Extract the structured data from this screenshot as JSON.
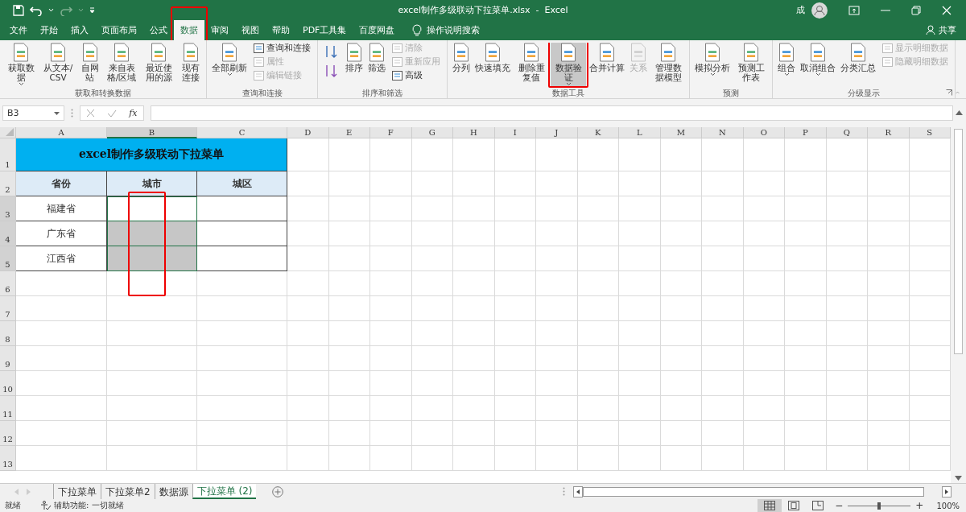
{
  "window": {
    "title": "excel制作多级联动下拉菜单.xlsx  -  Excel",
    "user": "成",
    "share": "共享"
  },
  "tabs": [
    {
      "label": "文件",
      "selected": false
    },
    {
      "label": "开始",
      "selected": false
    },
    {
      "label": "插入",
      "selected": false
    },
    {
      "label": "页面布局",
      "selected": false
    },
    {
      "label": "公式",
      "selected": false
    },
    {
      "label": "数据",
      "selected": true
    },
    {
      "label": "审阅",
      "selected": false
    },
    {
      "label": "视图",
      "selected": false
    },
    {
      "label": "帮助",
      "selected": false
    },
    {
      "label": "PDF工具集",
      "selected": false
    },
    {
      "label": "百度网盘",
      "selected": false
    }
  ],
  "tell_me": "操作说明搜索",
  "ribbon_groups": [
    {
      "label": "获取和转换数据",
      "items": [
        {
          "kind": "large",
          "label": "获取数据",
          "dropdown": true,
          "disabled": false,
          "selected": false
        },
        {
          "kind": "large",
          "label": "从文本/CSV",
          "dropdown": false,
          "disabled": false,
          "selected": false
        },
        {
          "kind": "large",
          "label": "自网站",
          "dropdown": false,
          "disabled": false,
          "selected": false
        },
        {
          "kind": "large",
          "label": "来自表格/区域",
          "dropdown": false,
          "disabled": false,
          "selected": false
        },
        {
          "kind": "large",
          "label": "最近使用的源",
          "dropdown": false,
          "disabled": false,
          "selected": false
        },
        {
          "kind": "large",
          "label": "现有连接",
          "dropdown": false,
          "disabled": false,
          "selected": false
        }
      ]
    },
    {
      "label": "查询和连接",
      "items": [
        {
          "kind": "large",
          "label": "全部刷新",
          "dropdown": true,
          "disabled": false,
          "selected": false
        },
        {
          "kind": "stack",
          "items": [
            {
              "label": "查询和连接",
              "disabled": false
            },
            {
              "label": "属性",
              "disabled": true
            },
            {
              "label": "编辑链接",
              "disabled": true
            }
          ]
        }
      ]
    },
    {
      "label": "排序和筛选",
      "items": [
        {
          "kind": "sort"
        },
        {
          "kind": "large",
          "label": "排序",
          "dropdown": false,
          "disabled": false,
          "selected": false
        },
        {
          "kind": "large",
          "label": "筛选",
          "dropdown": false,
          "disabled": false,
          "selected": false
        },
        {
          "kind": "stack",
          "items": [
            {
              "label": "清除",
              "disabled": true
            },
            {
              "label": "重新应用",
              "disabled": true
            },
            {
              "label": "高级",
              "disabled": false
            }
          ]
        }
      ]
    },
    {
      "label": "数据工具",
      "items": [
        {
          "kind": "large",
          "label": "分列",
          "dropdown": false,
          "disabled": false,
          "selected": false
        },
        {
          "kind": "large",
          "label": "快速填充",
          "dropdown": false,
          "disabled": false,
          "selected": false
        },
        {
          "kind": "large",
          "label": "删除重复值",
          "dropdown": false,
          "disabled": false,
          "selected": false
        },
        {
          "kind": "large",
          "label": "数据验证",
          "dropdown": true,
          "disabled": false,
          "selected": true
        },
        {
          "kind": "large",
          "label": "合并计算",
          "dropdown": false,
          "disabled": false,
          "selected": false
        },
        {
          "kind": "large",
          "label": "关系",
          "dropdown": false,
          "disabled": true,
          "selected": false
        },
        {
          "kind": "large",
          "label": "管理数据模型",
          "dropdown": false,
          "disabled": false,
          "selected": false
        }
      ]
    },
    {
      "label": "预测",
      "items": [
        {
          "kind": "large",
          "label": "模拟分析",
          "dropdown": true,
          "disabled": false,
          "selected": false
        },
        {
          "kind": "large",
          "label": "预测工作表",
          "dropdown": false,
          "disabled": false,
          "selected": false
        }
      ]
    },
    {
      "label": "分级显示",
      "items": [
        {
          "kind": "large",
          "label": "组合",
          "dropdown": true,
          "disabled": false,
          "selected": false
        },
        {
          "kind": "large",
          "label": "取消组合",
          "dropdown": true,
          "disabled": false,
          "selected": false
        },
        {
          "kind": "large",
          "label": "分类汇总",
          "dropdown": false,
          "disabled": false,
          "selected": false
        },
        {
          "kind": "stack",
          "items": [
            {
              "label": "显示明细数据",
              "disabled": true
            },
            {
              "label": "隐藏明细数据",
              "disabled": true
            }
          ]
        }
      ]
    }
  ],
  "formula_bar": {
    "name_box": "B3",
    "function_label": "fx"
  },
  "columns": [
    {
      "label": "A",
      "selected": false
    },
    {
      "label": "B",
      "selected": true
    },
    {
      "label": "C",
      "selected": false
    },
    {
      "label": "D",
      "selected": false
    },
    {
      "label": "E",
      "selected": false
    },
    {
      "label": "F",
      "selected": false
    },
    {
      "label": "G",
      "selected": false
    },
    {
      "label": "H",
      "selected": false
    },
    {
      "label": "I",
      "selected": false
    },
    {
      "label": "J",
      "selected": false
    },
    {
      "label": "K",
      "selected": false
    },
    {
      "label": "L",
      "selected": false
    },
    {
      "label": "M",
      "selected": false
    },
    {
      "label": "N",
      "selected": false
    },
    {
      "label": "O",
      "selected": false
    },
    {
      "label": "P",
      "selected": false
    },
    {
      "label": "Q",
      "selected": false
    },
    {
      "label": "R",
      "selected": false
    },
    {
      "label": "S",
      "selected": false
    }
  ],
  "rows": [
    {
      "number": "1",
      "selected": false
    },
    {
      "number": "2",
      "selected": false
    },
    {
      "number": "3",
      "selected": true
    },
    {
      "number": "4",
      "selected": true
    },
    {
      "number": "5",
      "selected": true
    },
    {
      "number": "6",
      "selected": false
    },
    {
      "number": "7",
      "selected": false
    },
    {
      "number": "8",
      "selected": false
    },
    {
      "number": "9",
      "selected": false
    },
    {
      "number": "10",
      "selected": false
    },
    {
      "number": "11",
      "selected": false
    },
    {
      "number": "12",
      "selected": false
    },
    {
      "number": "13",
      "selected": false
    }
  ],
  "table": {
    "title": "excel制作多级联动下拉菜单",
    "header": [
      "省份",
      "城市",
      "城区"
    ],
    "rows": [
      [
        {
          "text": "福建省",
          "selected": false,
          "active": false
        },
        {
          "selected": true,
          "active": true
        },
        {
          "selected": false,
          "active": false
        }
      ],
      [
        {
          "text": "广东省",
          "selected": false,
          "active": false
        },
        {
          "selected": true,
          "active": false
        },
        {
          "selected": false,
          "active": false
        }
      ],
      [
        {
          "text": "江西省",
          "selected": false,
          "active": false
        },
        {
          "selected": true,
          "active": false
        },
        {
          "selected": false,
          "active": false
        }
      ]
    ]
  },
  "sheet_tabs": [
    {
      "label": "下拉菜单",
      "selected": false
    },
    {
      "label": "下拉菜单2",
      "selected": false
    },
    {
      "label": "数据源",
      "selected": false
    },
    {
      "label": "下拉菜单 (2)",
      "selected": true
    }
  ],
  "status_bar": {
    "ready": "就绪",
    "accessibility": "辅助功能: 一切就绪",
    "views": [
      {
        "selected": true
      },
      {
        "selected": false
      },
      {
        "selected": false
      }
    ],
    "zoom_out": "−",
    "zoom_in": "+",
    "zoom": {
      "level": 0.5
    },
    "zoom_label": "100%"
  }
}
